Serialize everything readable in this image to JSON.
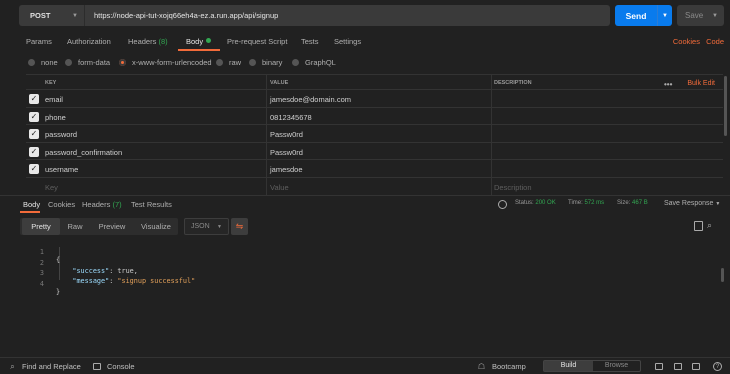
{
  "request": {
    "method": "POST",
    "url": "https://node-api-tut-xojq66eh4a-ez.a.run.app/api/signup",
    "send_label": "Send",
    "save_label": "Save"
  },
  "request_tabs": [
    {
      "label": "Params"
    },
    {
      "label": "Authorization"
    },
    {
      "label": "Headers",
      "count": "(8)"
    },
    {
      "label": "Body"
    },
    {
      "label": "Pre-request Script"
    },
    {
      "label": "Tests"
    },
    {
      "label": "Settings"
    }
  ],
  "request_tabs_right": {
    "cookies": "Cookies",
    "code": "Code"
  },
  "body_types": {
    "options": [
      "none",
      "form-data",
      "x-www-form-urlencoded",
      "raw",
      "binary",
      "GraphQL"
    ],
    "selected": "x-www-form-urlencoded"
  },
  "params_table": {
    "headers": {
      "key": "KEY",
      "value": "VALUE",
      "description": "DESCRIPTION"
    },
    "bulk_edit": "Bulk Edit",
    "rows": [
      {
        "key": "email",
        "value": "jamesdoe@domain.com",
        "description": "",
        "checked": true
      },
      {
        "key": "phone",
        "value": "0812345678",
        "description": "",
        "checked": true
      },
      {
        "key": "password",
        "value": "Passw0rd",
        "description": "",
        "checked": true
      },
      {
        "key": "password_confirmation",
        "value": "Passw0rd",
        "description": "",
        "checked": true
      },
      {
        "key": "username",
        "value": "jamesdoe",
        "description": "",
        "checked": true
      }
    ],
    "placeholder": {
      "key": "Key",
      "value": "Value",
      "description": "Description"
    }
  },
  "response_tabs": [
    {
      "label": "Body"
    },
    {
      "label": "Cookies"
    },
    {
      "label": "Headers",
      "count": "(7)"
    },
    {
      "label": "Test Results"
    }
  ],
  "response_status": {
    "status_label": "Status:",
    "status": "200 OK",
    "time_label": "Time:",
    "time": "572 ms",
    "size_label": "Size:",
    "size": "467 B",
    "save_response": "Save Response"
  },
  "view_modes": [
    "Pretty",
    "Raw",
    "Preview",
    "Visualize"
  ],
  "active_view": "Pretty",
  "format": "JSON",
  "response_body": {
    "line_numbers": [
      "1",
      "2",
      "3",
      "4"
    ],
    "open_brace": "{",
    "close_brace": "}",
    "success_key": "\"success\"",
    "success_value": "true",
    "message_key": "\"message\"",
    "message_value": "\"signup successful\""
  },
  "footer": {
    "find_replace": "Find and Replace",
    "console": "Console",
    "bootcamp": "Bootcamp",
    "build": "Build",
    "browse": "Browse"
  },
  "colors": {
    "accent": "#f26b3a",
    "send_button": "#097bed",
    "success_green": "#32a852",
    "background": "#212121"
  },
  "icons": [
    "chevron-down-icon",
    "checkbox-icon",
    "more-options-icon",
    "globe-icon",
    "wrap-icon",
    "copy-icon",
    "search-icon",
    "find-replace-icon",
    "console-icon",
    "bootcamp-icon",
    "layout-icon",
    "keyboard-icon",
    "help-icon"
  ]
}
